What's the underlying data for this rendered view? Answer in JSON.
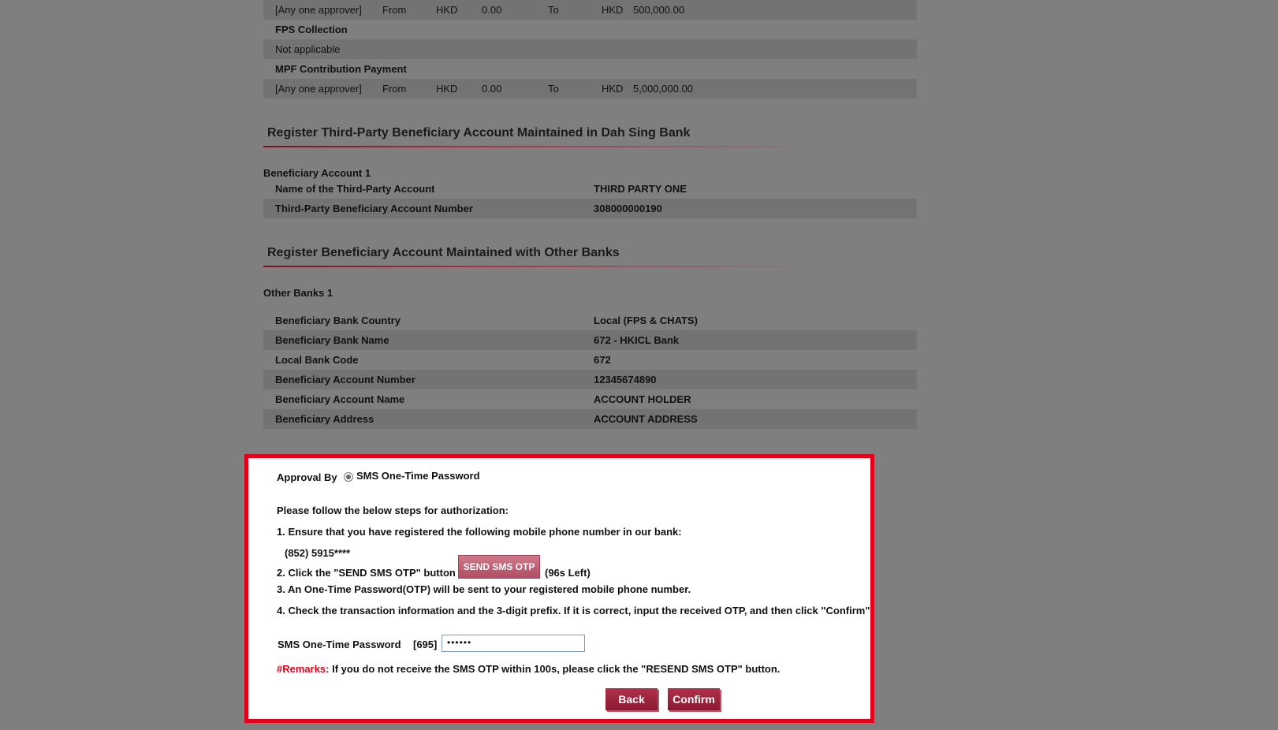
{
  "limits": {
    "rows": [
      {
        "approver": "[Any one approver]",
        "from_label": "From",
        "from_ccy": "HKD",
        "from_amt": "0.00",
        "to_label": "To",
        "to_ccy": "HKD",
        "to_amt": "500,000.00"
      },
      {
        "approver": "[Any one approver]",
        "from_label": "From",
        "from_ccy": "HKD",
        "from_amt": "0.00",
        "to_label": "To",
        "to_ccy": "HKD",
        "to_amt": "5,000,000.00"
      }
    ],
    "fps_heading": "FPS Collection",
    "fps_value": "Not applicable",
    "mpf_heading": "MPF Contribution Payment"
  },
  "third_party": {
    "title": "Register Third-Party Beneficiary Account Maintained in Dah Sing Bank",
    "subheading": "Beneficiary Account  1",
    "items": [
      {
        "label": "Name of the Third-Party Account",
        "value": "THIRD PARTY ONE"
      },
      {
        "label": "Third-Party Beneficiary Account Number",
        "value": "308000000190"
      }
    ]
  },
  "other_banks": {
    "title": "Register Beneficiary Account Maintained with Other Banks",
    "subheading": "Other Banks 1",
    "items": [
      {
        "label": "Beneficiary Bank Country",
        "value": "Local (FPS & CHATS)"
      },
      {
        "label": "Beneficiary Bank Name",
        "value": "672 - HKICL Bank"
      },
      {
        "label": "Local Bank Code",
        "value": "672"
      },
      {
        "label": "Beneficiary Account Number",
        "value": "12345674890"
      },
      {
        "label": "Beneficiary Account Name",
        "value": "ACCOUNT HOLDER"
      },
      {
        "label": "Beneficiary Address",
        "value": "ACCOUNT ADDRESS"
      }
    ]
  },
  "approval": {
    "approval_label": "Approval By",
    "method": "SMS One-Time Password",
    "intro": "Please follow the below steps for authorization:",
    "step1": "1. Ensure that you have registered the following mobile phone number in our bank:",
    "phone": "(852) 5915****",
    "step2": "2. Click the \"SEND SMS OTP\" button",
    "send_button": "SEND SMS OTP",
    "countdown": "(96s Left)",
    "step3": "3. An One-Time Password(OTP) will be sent to your registered mobile phone number.",
    "step4": "4. Check the transaction information and the 3-digit prefix. If it is correct, input the received OTP, and then click \"Confirm\"",
    "otp_label": "SMS One-Time Password",
    "otp_prefix": "[695]",
    "otp_value": "••••••",
    "remarks_label": "#Remarks:",
    "remarks_text": " If you do not receive the SMS OTP within 100s, please click the \"RESEND SMS OTP\" button.",
    "back_button": "Back",
    "confirm_button": "Confirm"
  },
  "colors": {
    "accent": "#e3001b",
    "brand": "#8a1a32",
    "overlay": "#7f7f7f"
  }
}
